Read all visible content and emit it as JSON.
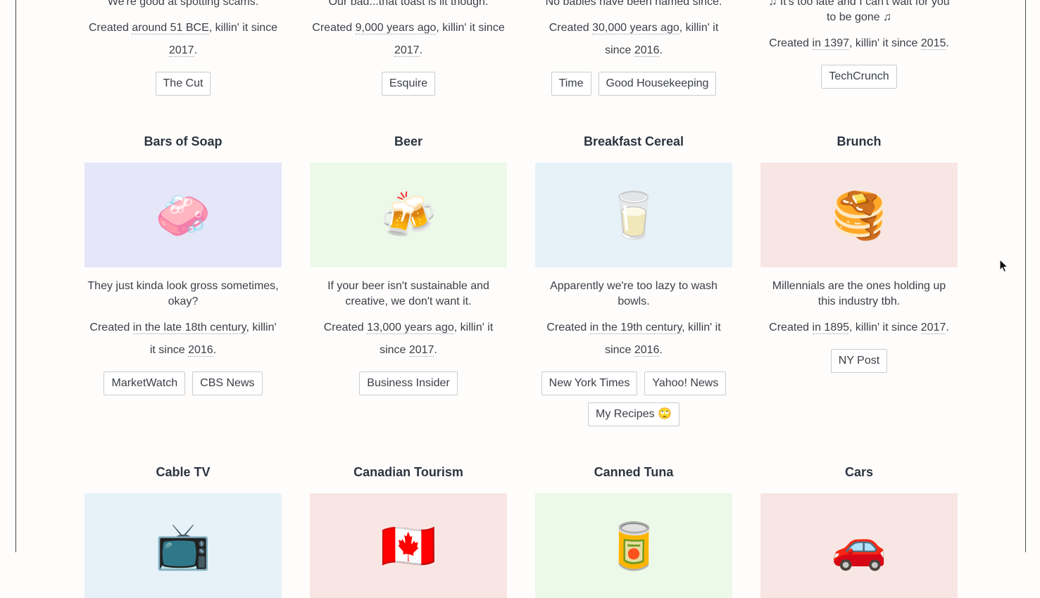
{
  "top_cards": [
    {
      "desc": "We're good at spotting scams.",
      "pre": "Created ",
      "origin": "around 51 BCE",
      "mid": ", killin' it since ",
      "since": "2017",
      "post": ".",
      "tags": [
        "The Cut"
      ]
    },
    {
      "desc": "Our bad...that toast is lit though.",
      "pre": "Created ",
      "origin": "9,000 years ago",
      "mid": ", killin' it since ",
      "since": "2017",
      "post": ".",
      "tags": [
        "Esquire"
      ]
    },
    {
      "desc": "No babies have been named since.",
      "pre": "Created ",
      "origin": "30,000 years ago",
      "mid": ", killin' it since ",
      "since": "2016",
      "post": ".",
      "tags": [
        "Time",
        "Good Housekeeping"
      ]
    },
    {
      "desc": "♫ It's too late and I can't wait for you to be gone ♫",
      "pre": "Created ",
      "origin": "in 1397",
      "mid": ", killin' it since ",
      "since": "2015",
      "post": ".",
      "tags": [
        "TechCrunch"
      ]
    }
  ],
  "mid_cards": [
    {
      "title": "Bars of Soap",
      "emoji": "🧼",
      "color": "purple",
      "desc": "They just kinda look gross sometimes, okay?",
      "pre": "Created ",
      "origin": "in the late 18th century",
      "mid": ", killin' it since ",
      "since": "2016",
      "post": ".",
      "tags": [
        "MarketWatch",
        "CBS News"
      ]
    },
    {
      "title": "Beer",
      "emoji": "🍻",
      "color": "green",
      "desc": "If your beer isn't sustainable and creative, we don't want it.",
      "pre": "Created ",
      "origin": "13,000 years ago",
      "mid": ", killin' it since ",
      "since": "2017",
      "post": ".",
      "tags": [
        "Business Insider"
      ]
    },
    {
      "title": "Breakfast Cereal",
      "emoji": "🥛",
      "color": "blue",
      "desc": "Apparently we're too lazy to wash bowls.",
      "pre": "Created ",
      "origin": "in the 19th century",
      "mid": ", killin' it since ",
      "since": "2016",
      "post": ".",
      "tags": [
        "New York Times",
        "Yahoo! News",
        "My Recipes 🙄"
      ]
    },
    {
      "title": "Brunch",
      "emoji": "🥞",
      "color": "pink",
      "desc": "Millennials are the ones holding up this industry tbh.",
      "pre": "Created ",
      "origin": "in 1895",
      "mid": ", killin' it since ",
      "since": "2017",
      "post": ".",
      "tags": [
        "NY Post"
      ]
    }
  ],
  "bottom_cards": [
    {
      "title": "Cable TV",
      "emoji": "📺",
      "color": "blue"
    },
    {
      "title": "Canadian Tourism",
      "emoji": "🇨🇦",
      "color": "pink"
    },
    {
      "title": "Canned Tuna",
      "emoji": "🥫",
      "color": "green"
    },
    {
      "title": "Cars",
      "emoji": "🚗",
      "color": "pink"
    }
  ]
}
